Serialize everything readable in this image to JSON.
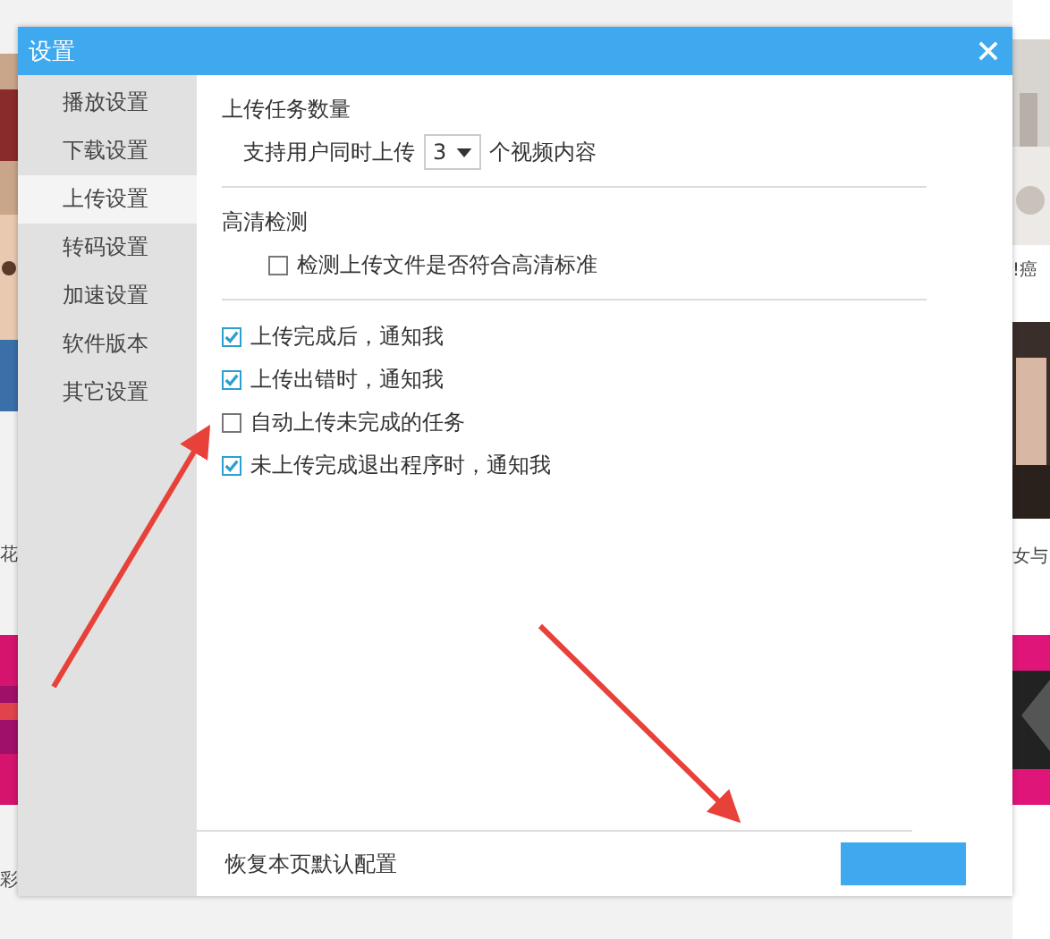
{
  "background": {
    "captions_left": [
      "花",
      "彩"
    ],
    "captions_right": [
      "!癌",
      "女与"
    ]
  },
  "dialog": {
    "title": "设置",
    "sidebar": [
      {
        "label": "播放设置",
        "selected": false
      },
      {
        "label": "下载设置",
        "selected": false
      },
      {
        "label": "上传设置",
        "selected": true
      },
      {
        "label": "转码设置",
        "selected": false
      },
      {
        "label": "加速设置",
        "selected": false
      },
      {
        "label": "软件版本",
        "selected": false
      },
      {
        "label": "其它设置",
        "selected": false
      }
    ],
    "upload_count": {
      "title": "上传任务数量",
      "prefix": "支持用户同时上传",
      "value": "3",
      "suffix": "个视频内容"
    },
    "hd_check": {
      "title": "高清检测",
      "option": {
        "label": "检测上传文件是否符合高清标准",
        "checked": false
      }
    },
    "notifications": [
      {
        "label": "上传完成后，通知我",
        "checked": true
      },
      {
        "label": "上传出错时，通知我",
        "checked": true
      },
      {
        "label": "自动上传未完成的任务",
        "checked": false
      },
      {
        "label": "未上传完成退出程序时，通知我",
        "checked": true
      }
    ],
    "footer": {
      "reset": "恢复本页默认配置"
    }
  }
}
